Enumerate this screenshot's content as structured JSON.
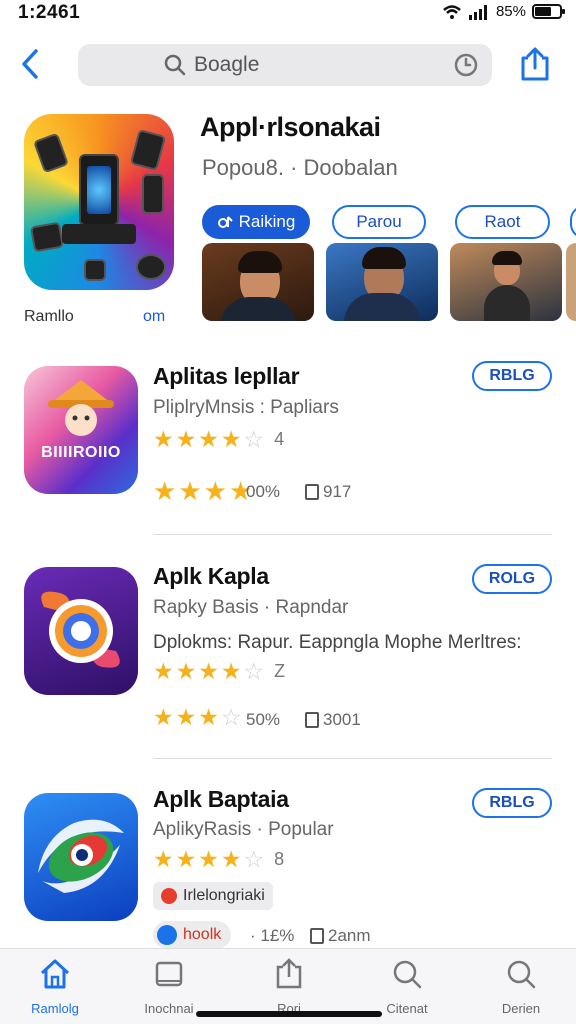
{
  "status": {
    "time": "1:2461",
    "battery": "85%"
  },
  "search": {
    "query": "Boagle"
  },
  "featured": {
    "title": "Appl·rlsonakai",
    "subtitle": "Popou8. · Doobalan",
    "chips": [
      "Raiking",
      "Parou",
      "Raot"
    ],
    "left_label": "Ramllo",
    "right_label": "om"
  },
  "apps": [
    {
      "title": "Aplitas lepllar",
      "subtitle": "PliplryMnsis : Papliars",
      "rating_text": "4",
      "stat_pct": "00%",
      "stat_count": "917",
      "button": "RBLG",
      "icon_text": "BIIIIROIIO"
    },
    {
      "title": "Aplk Kapla",
      "subtitle": "Rapky Basis · Rapndar",
      "description": "Dplokms: Rapur. Eappngla Mophe Merltres:",
      "rating_text": "Z",
      "stat_pct": "50%",
      "stat_count": "3001",
      "button": "ROLG"
    },
    {
      "title": "Aplk Baptaia",
      "subtitle": "AplikyRasis · Popular",
      "rating_text": "8",
      "tag": "Irlelongriaki",
      "tag2": "hoolk",
      "stat_pct": "· 1£%",
      "stat_count": "2anm",
      "button": "RBLG"
    }
  ],
  "tabs": [
    "Ramlolg",
    "Inochnai",
    "Rori",
    "Citenat",
    "Derien"
  ],
  "colors": {
    "accent": "#1a73e8",
    "star": "#f6b21b"
  }
}
